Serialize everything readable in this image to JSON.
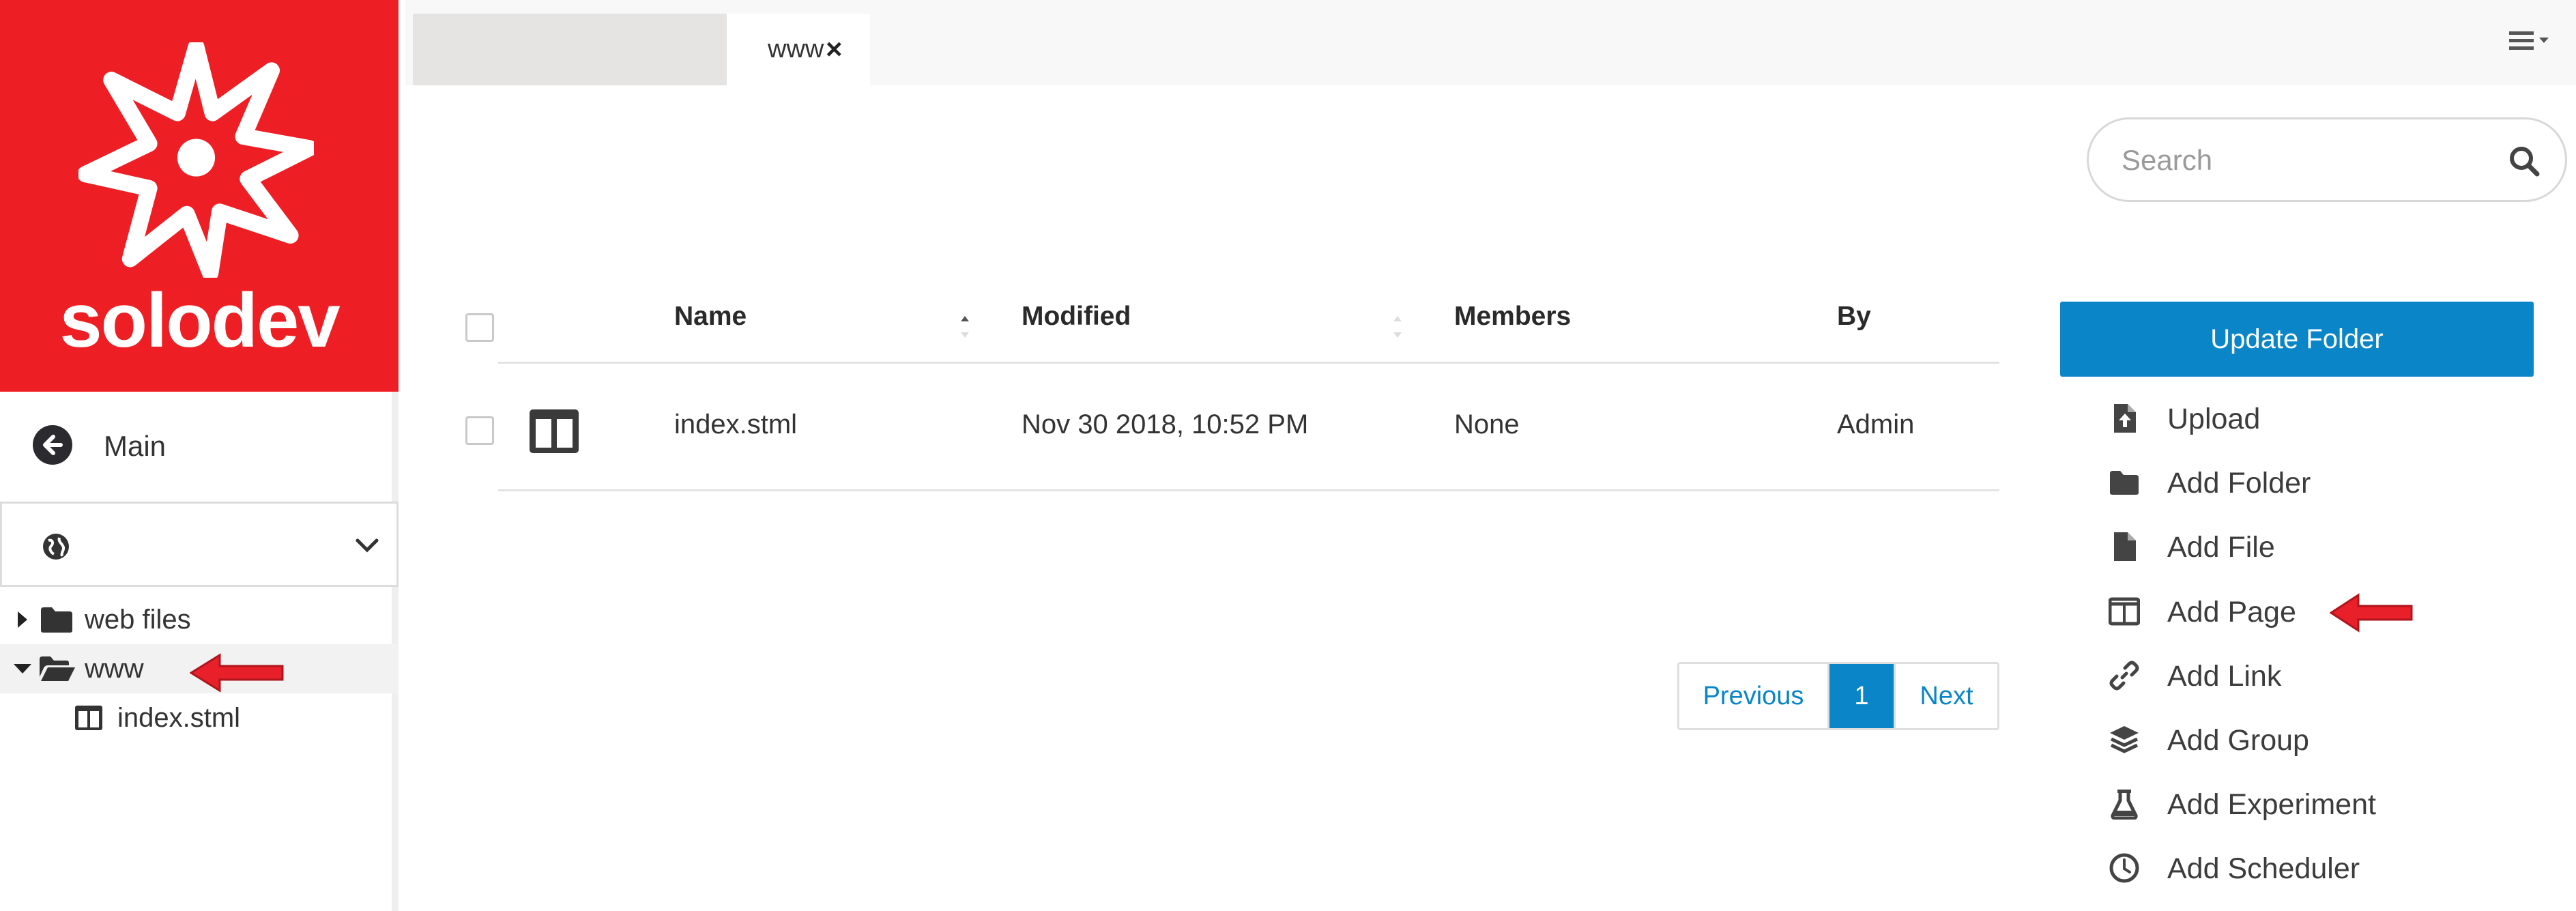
{
  "sidebar": {
    "logo_text": "solodev",
    "nav_main_label": "Main",
    "tree": [
      {
        "label": "web files",
        "icon": "folder-icon",
        "expanded": false
      },
      {
        "label": "www",
        "icon": "folder-open-icon",
        "expanded": true
      },
      {
        "label": "index.stml",
        "icon": "page-icon"
      }
    ]
  },
  "tabs": [
    {
      "label": "",
      "active": false
    },
    {
      "label": "www",
      "active": true,
      "close": "×"
    }
  ],
  "search": {
    "placeholder": "Search",
    "value": ""
  },
  "table": {
    "columns": [
      "Name",
      "Modified",
      "Members",
      "By"
    ],
    "rows": [
      {
        "icon": "page-icon",
        "name": "index.stml",
        "modified": "Nov 30 2018, 10:52 PM",
        "members": "None",
        "by": "Admin"
      }
    ]
  },
  "pagination": {
    "previous": "Previous",
    "current": "1",
    "next": "Next"
  },
  "actions": {
    "update_folder": "Update Folder",
    "items": [
      {
        "label": "Upload",
        "icon": "upload-file-icon"
      },
      {
        "label": "Add Folder",
        "icon": "folder-icon"
      },
      {
        "label": "Add File",
        "icon": "file-icon"
      },
      {
        "label": "Add Page",
        "icon": "page-icon"
      },
      {
        "label": "Add Link",
        "icon": "link-icon"
      },
      {
        "label": "Add Group",
        "icon": "layers-icon"
      },
      {
        "label": "Add Experiment",
        "icon": "flask-icon"
      },
      {
        "label": "Add Scheduler",
        "icon": "clock-icon"
      }
    ]
  },
  "colors": {
    "brand_red": "#ee1f24",
    "accent_blue": "#0a85c8",
    "arrow_red": "#e8202a"
  }
}
